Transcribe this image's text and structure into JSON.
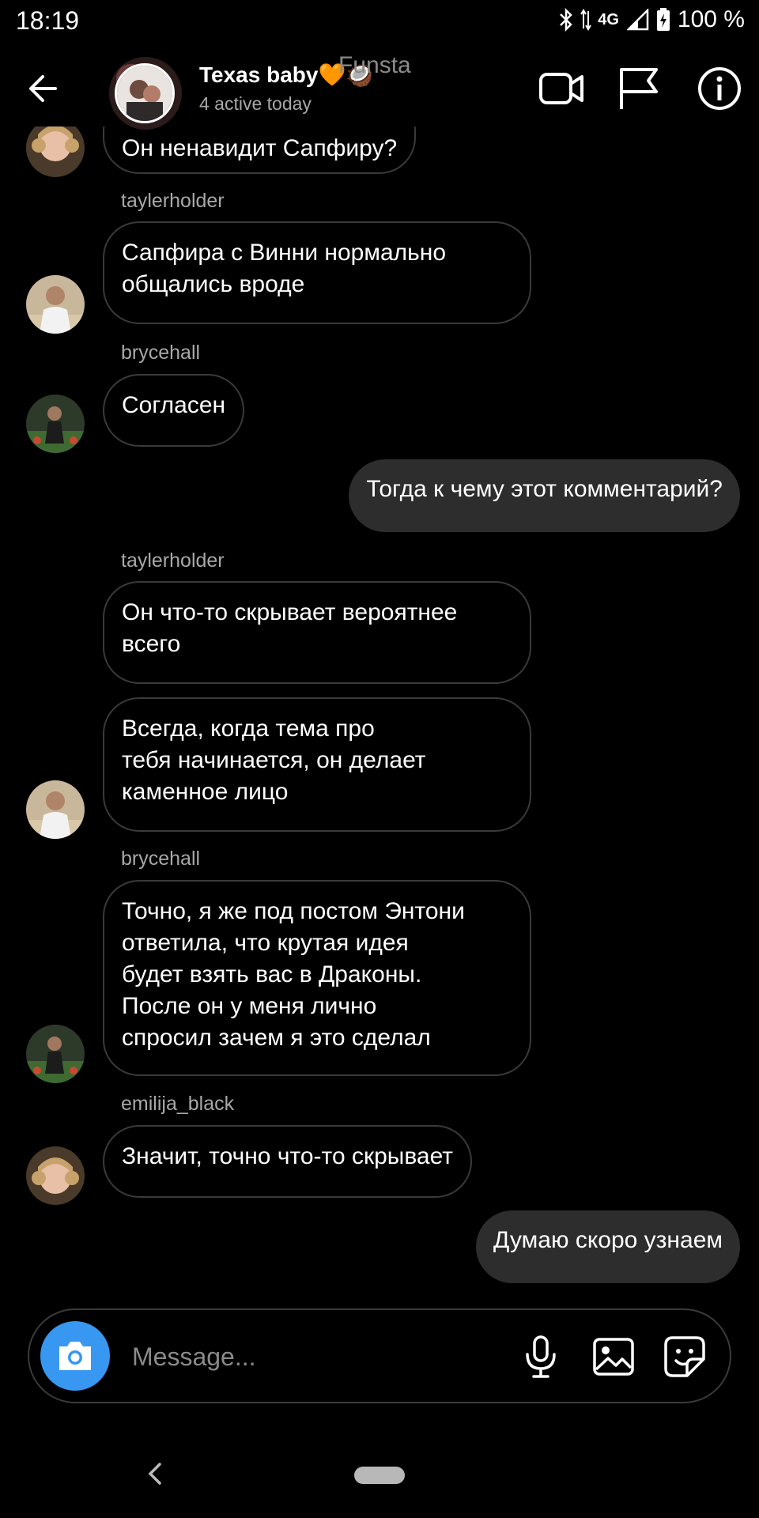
{
  "status_bar": {
    "time": "18:19",
    "network": "4G",
    "battery": "100 %"
  },
  "header": {
    "title": "Texas baby🧡🥥",
    "subtitle": "4 active today",
    "watermark": "Funsta"
  },
  "messages": [
    {
      "sender": "emilija_black",
      "text": "Он ненавидит Сапфиру?",
      "outgoing": false
    },
    {
      "sender": "taylerholder",
      "text": "Сапфира с Винни нормально\nобщались вроде",
      "outgoing": false
    },
    {
      "sender": "brycehall",
      "text": "Согласен",
      "outgoing": false
    },
    {
      "sender": "me",
      "text": "Тогда к чему этот комментарий?",
      "outgoing": true
    },
    {
      "sender": "taylerholder",
      "text": "Он что-то скрывает вероятнее\nвсего",
      "outgoing": false
    },
    {
      "sender": "taylerholder",
      "text": "Всегда, когда тема про\nтебя начинается, он делает\nкаменное лицо",
      "outgoing": false
    },
    {
      "sender": "brycehall",
      "text": "Точно, я же под постом Энтони\nответила, что крутая идея\nбудет взять вас в Драконы.\nПосле он у меня лично\nспросил зачем я это сделал",
      "outgoing": false
    },
    {
      "sender": "emilija_black",
      "text": "Значит, точно что-то скрывает",
      "outgoing": false
    },
    {
      "sender": "me",
      "text": "Думаю скоро узнаем",
      "outgoing": true
    }
  ],
  "usernames": {
    "u1": "taylerholder",
    "u2": "brycehall",
    "u3": "taylerholder",
    "u4": "brycehall",
    "u5": "emilija_black"
  },
  "composer": {
    "placeholder": "Message..."
  },
  "colors": {
    "background": "#000000",
    "accent": "#3897f0",
    "outgoing_bubble": "#2d2d2d",
    "bubble_border": "#3a3a3a",
    "muted_text": "#a8a8a8"
  },
  "icons": [
    "back-arrow-icon",
    "video-call-icon",
    "flag-icon",
    "info-icon",
    "camera-icon",
    "microphone-icon",
    "gallery-icon",
    "sticker-icon"
  ]
}
